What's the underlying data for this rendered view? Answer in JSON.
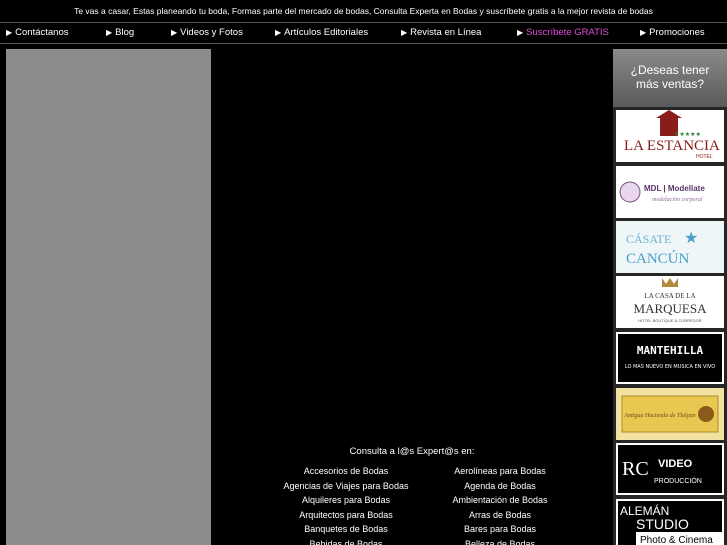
{
  "topbar": {
    "text": "Te vas a casar, Estas planeando tu boda, Formas parte del mercado de bodas, Consulta Experta en Bodas y suscríbete gratis a la mejor revista de bodas"
  },
  "nav": {
    "items": [
      {
        "label": "Contáctanos"
      },
      {
        "label": "Blog"
      },
      {
        "label": "Videos y Fotos"
      },
      {
        "label": "Artículos Editoriales"
      },
      {
        "label": "Revista en Línea"
      },
      {
        "label": "Suscríbete GRATIS"
      },
      {
        "label": "Promociones"
      }
    ]
  },
  "consulta": {
    "title": "Consulta a l@s Expert@s en:"
  },
  "links": {
    "col1": [
      "Accesorios de Bodas",
      "Agencias de Viajes para Bodas",
      "Alquileres para Bodas",
      "Arquitectos para Bodas",
      "Banquetes de Bodas",
      "Bebidas de Bodas"
    ],
    "col2": [
      "Aerolíneas para Bodas",
      "Agenda de Bodas",
      "Ambientación de Bodas",
      "Arras de Bodas",
      "Bares para Bodas",
      "Belleza de Bodas"
    ]
  },
  "ads": {
    "header_line1": "¿Deseas tener",
    "header_line2": "más ventas?",
    "estancia": {
      "name": "LA ESTANCIA",
      "stars": "★★★★★",
      "sub": "HOTEL"
    },
    "mdl": {
      "name": "MDL | Modellate",
      "tag": "modelación corporal"
    },
    "cancun": {
      "l1": "CÁSATE",
      "l2": "CANCÚN"
    },
    "marquesa": {
      "l1": "LA CASA DE LA",
      "l2": "MARQUESA",
      "l3": "HOTEL BOUTIQUE & CORREDOR"
    },
    "mantehilla": {
      "name": "MANTEHILLA",
      "tag": "LO MAS NUEVO EN MUSICA EN VIVO"
    },
    "hacienda": {
      "name": "Antigua Hacienda de Tlalpan"
    },
    "rc": {
      "l1": "RC",
      "l2": "VIDEO",
      "l3": "PRODUCCIÓN"
    },
    "aleman": {
      "l1": "ALEMÁN",
      "l2": "STUDIO",
      "l3": "Photo & Cinema"
    }
  },
  "colors": {
    "highlight": "#e04bd8",
    "left_panel": "#8c8c8c",
    "estancia_red": "#8a1c1c",
    "cancun_blue": "#4aa0c8"
  }
}
